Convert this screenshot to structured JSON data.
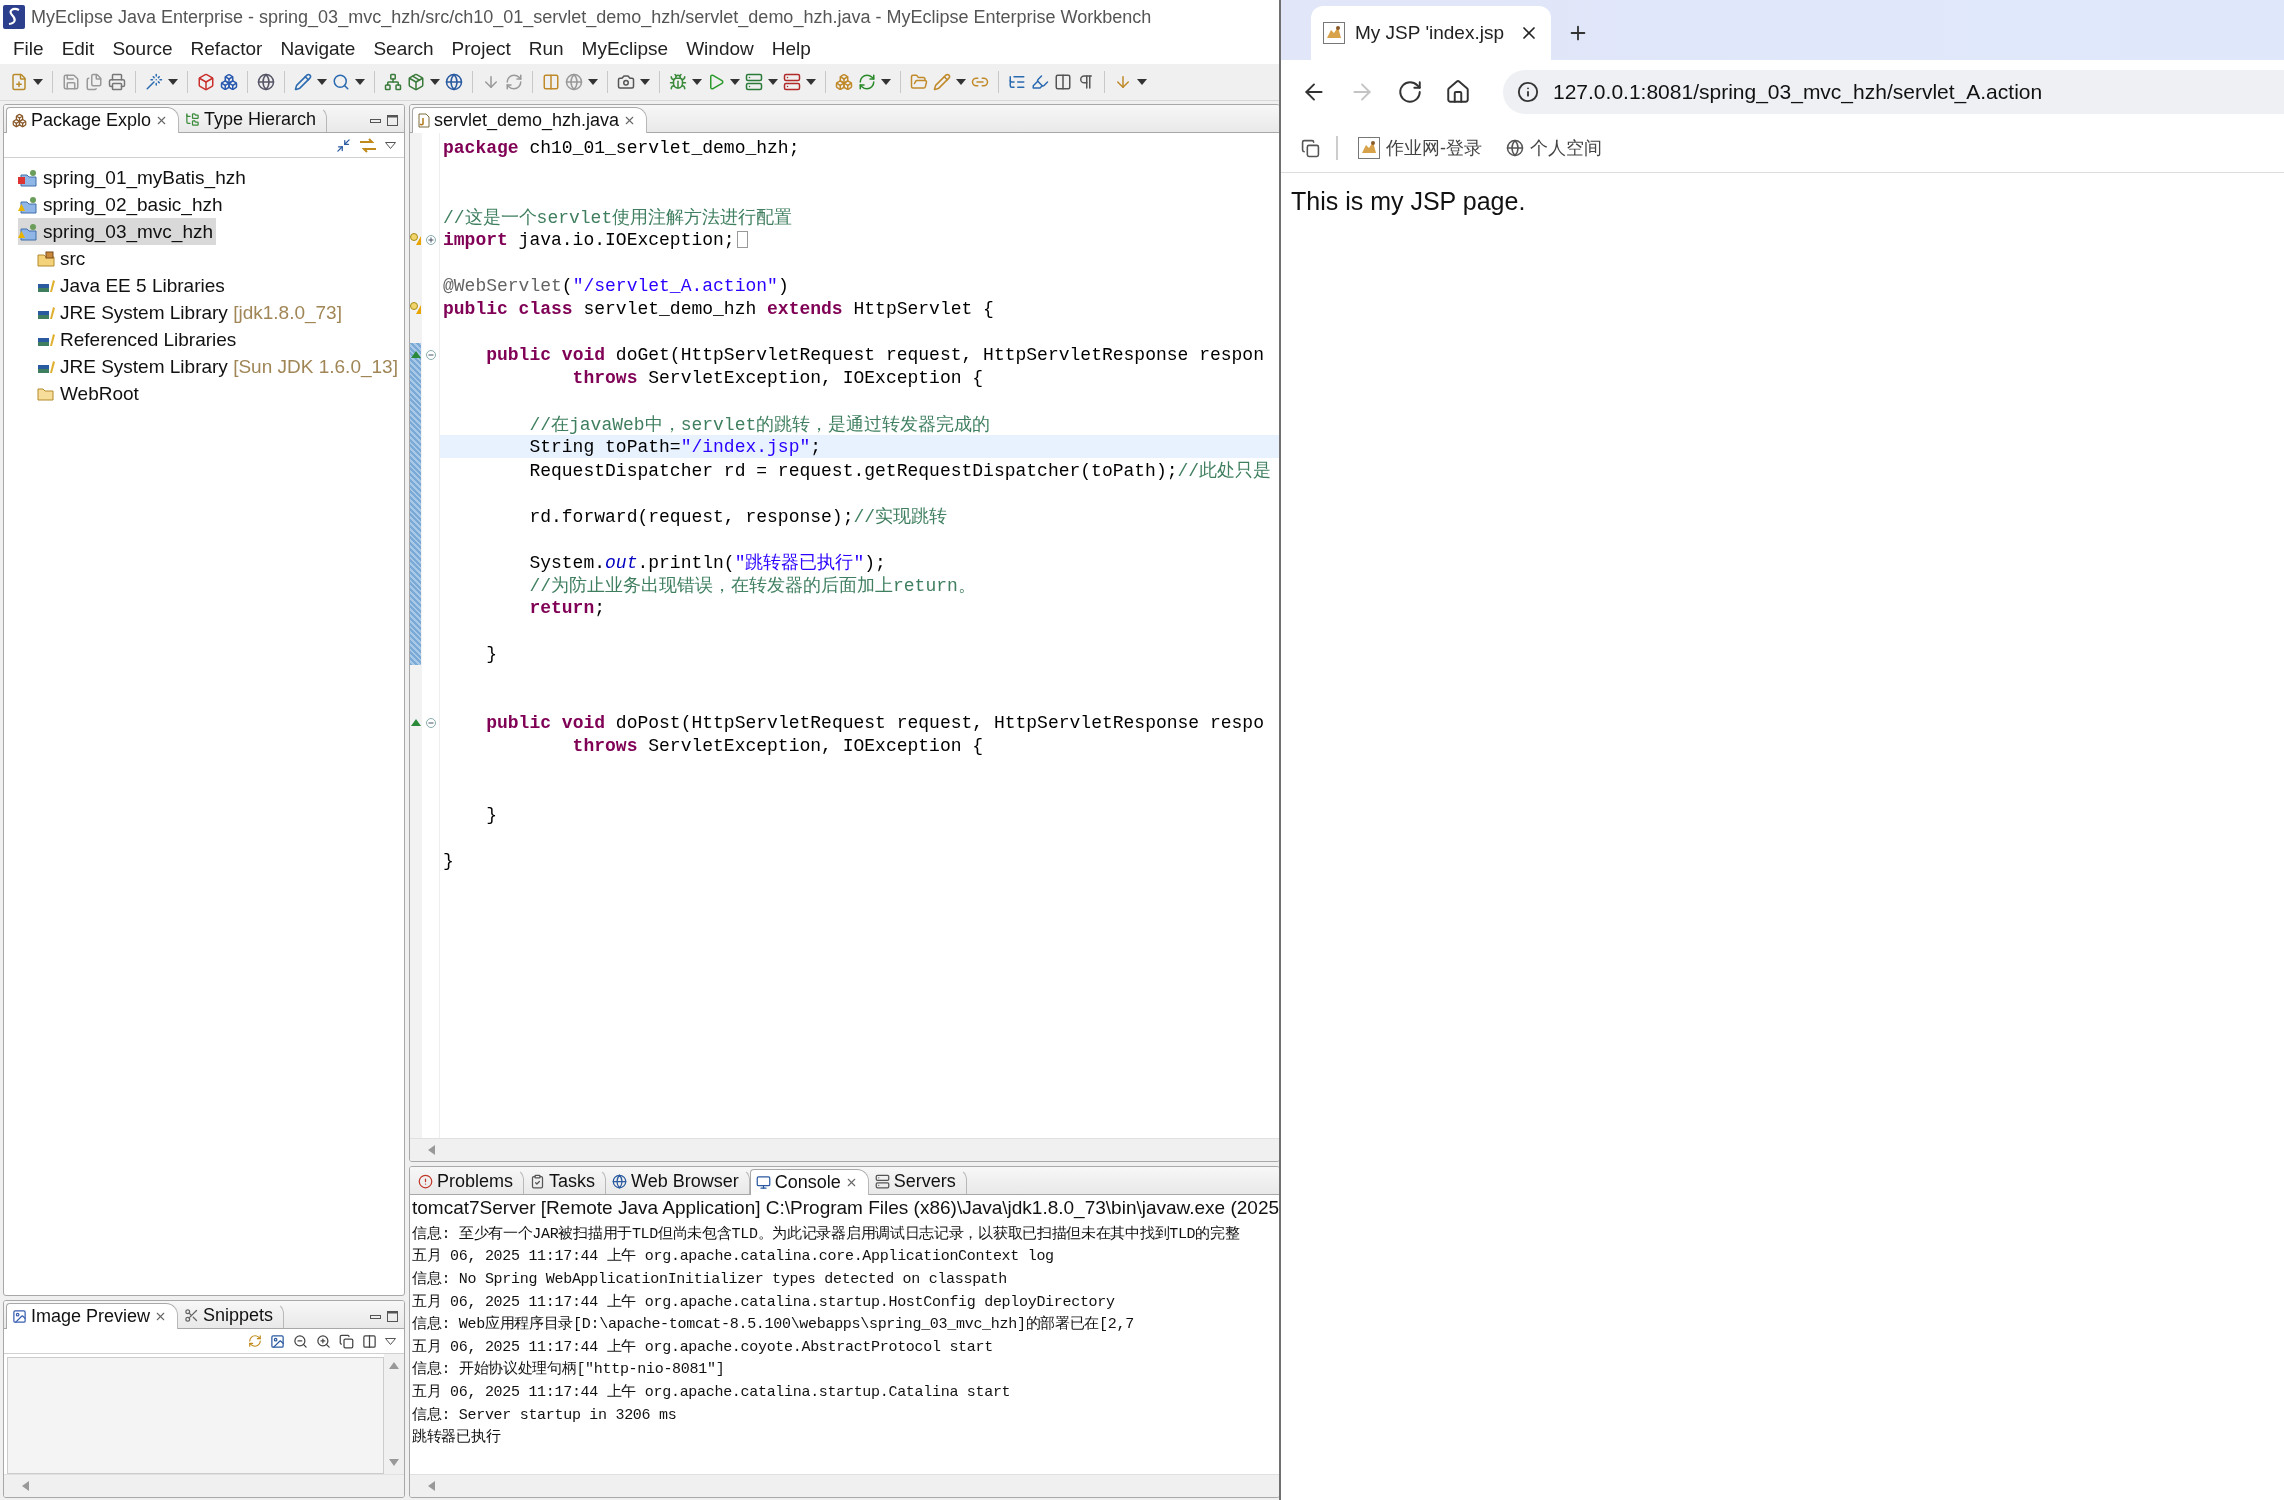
{
  "window": {
    "title": "MyEclipse Java Enterprise - spring_03_mvc_hzh/src/ch10_01_servlet_demo_hzh/servlet_demo_hzh.java - MyEclipse Enterprise Workbench"
  },
  "menu": [
    "File",
    "Edit",
    "Source",
    "Refactor",
    "Navigate",
    "Search",
    "Project",
    "Run",
    "MyEclipse",
    "Window",
    "Help"
  ],
  "explorer": {
    "tabs": [
      {
        "label": "Package Explo",
        "kind": "package",
        "selected": true
      },
      {
        "label": "Type Hierarch",
        "kind": "hierarchy",
        "selected": false
      }
    ],
    "tree": [
      {
        "label": "spring_01_myBatis_hzh",
        "kind": "project",
        "error": true,
        "warning": false,
        "selected": false
      },
      {
        "label": "spring_02_basic_hzh",
        "kind": "project",
        "error": false,
        "warning": true,
        "selected": false
      },
      {
        "label": "spring_03_mvc_hzh",
        "kind": "project",
        "error": false,
        "warning": true,
        "selected": true,
        "children": [
          {
            "label": "src",
            "kind": "source",
            "selected": false
          },
          {
            "label": "Java EE 5 Libraries",
            "kind": "library",
            "selected": false
          },
          {
            "label": "JRE System Library",
            "decoration": "[jdk1.8.0_73]",
            "kind": "library",
            "selected": false
          },
          {
            "label": "Referenced Libraries",
            "kind": "library",
            "selected": false
          },
          {
            "label": "JRE System Library",
            "decoration": "[Sun JDK 1.6.0_13]",
            "kind": "library",
            "selected": false
          },
          {
            "label": "WebRoot",
            "kind": "folder",
            "selected": false
          }
        ]
      }
    ]
  },
  "preview": {
    "tabs": [
      {
        "label": "Image Preview",
        "kind": "image",
        "selected": true
      },
      {
        "label": "Snippets",
        "kind": "snippets",
        "selected": false
      }
    ]
  },
  "editor": {
    "tabs": [
      {
        "label": "servlet_demo_hzh.java",
        "kind": "java",
        "selected": true
      }
    ],
    "lines": [
      {
        "kind": "code",
        "current": false,
        "scope": false,
        "tokens": [
          {
            "kind": "kw",
            "text": "package"
          },
          {
            "kind": "plain",
            "text": " ch10_01_servlet_demo_hzh;"
          }
        ]
      },
      {
        "kind": "blank",
        "current": false,
        "scope": false
      },
      {
        "kind": "blank",
        "current": false,
        "scope": false
      },
      {
        "kind": "code",
        "current": false,
        "scope": false,
        "tokens": [
          {
            "kind": "comment",
            "text": "//这是一个servlet使用注解方法进行配置"
          }
        ]
      },
      {
        "kind": "code",
        "current": false,
        "scope": false,
        "warning": true,
        "folded": true,
        "tokens": [
          {
            "kind": "kw",
            "text": "import"
          },
          {
            "kind": "plain",
            "text": " java.io.IOException;"
          }
        ]
      },
      {
        "kind": "blank",
        "current": false,
        "scope": false
      },
      {
        "kind": "code",
        "current": false,
        "scope": false,
        "tokens": [
          {
            "kind": "annot",
            "text": "@WebServlet"
          },
          {
            "kind": "plain",
            "text": "("
          },
          {
            "kind": "str",
            "text": "\"/servlet_A.action\""
          },
          {
            "kind": "plain",
            "text": ")"
          }
        ]
      },
      {
        "kind": "code",
        "current": false,
        "scope": false,
        "warning": true,
        "tokens": [
          {
            "kind": "kw",
            "text": "public"
          },
          {
            "kind": "kw",
            "text": " class"
          },
          {
            "kind": "plain",
            "text": " servlet_demo_hzh "
          },
          {
            "kind": "kw",
            "text": "extends"
          },
          {
            "kind": "plain",
            "text": " HttpServlet {"
          }
        ]
      },
      {
        "kind": "blank",
        "current": false,
        "scope": false
      },
      {
        "kind": "code",
        "current": false,
        "scope": true,
        "override": true,
        "folded": false,
        "tokens": [
          {
            "kind": "kw",
            "text": "    public"
          },
          {
            "kind": "kw",
            "text": " void"
          },
          {
            "kind": "plain",
            "text": " doGet(HttpServletRequest request, HttpServletResponse respon"
          }
        ]
      },
      {
        "kind": "code",
        "current": false,
        "scope": true,
        "tokens": [
          {
            "kind": "kw",
            "text": "            throws"
          },
          {
            "kind": "plain",
            "text": " ServletException, IOException {"
          }
        ]
      },
      {
        "kind": "blank",
        "current": false,
        "scope": true
      },
      {
        "kind": "code",
        "current": false,
        "scope": true,
        "tokens": [
          {
            "kind": "comment",
            "text": "        //在javaWeb中，servlet的跳转，是通过转发器完成的"
          }
        ]
      },
      {
        "kind": "code",
        "current": true,
        "scope": true,
        "tokens": [
          {
            "kind": "plain",
            "text": "        String toPath="
          },
          {
            "kind": "str",
            "text": "\"/index.jsp\""
          },
          {
            "kind": "plain",
            "text": ";"
          }
        ]
      },
      {
        "kind": "code",
        "current": false,
        "scope": true,
        "tokens": [
          {
            "kind": "plain",
            "text": "        RequestDispatcher rd = request.getRequestDispatcher(toPath);"
          },
          {
            "kind": "comment",
            "text": "//此处只是"
          }
        ]
      },
      {
        "kind": "blank",
        "current": false,
        "scope": true
      },
      {
        "kind": "code",
        "current": false,
        "scope": true,
        "tokens": [
          {
            "kind": "plain",
            "text": "        rd.forward(request, response);"
          },
          {
            "kind": "comment",
            "text": "//实现跳转"
          }
        ]
      },
      {
        "kind": "blank",
        "current": false,
        "scope": true
      },
      {
        "kind": "code",
        "current": false,
        "scope": true,
        "tokens": [
          {
            "kind": "plain",
            "text": "        System."
          },
          {
            "kind": "field",
            "text": "out"
          },
          {
            "kind": "plain",
            "text": ".println("
          },
          {
            "kind": "str",
            "text": "\"跳转器已执行\""
          },
          {
            "kind": "plain",
            "text": ");"
          }
        ]
      },
      {
        "kind": "code",
        "current": false,
        "scope": true,
        "tokens": [
          {
            "kind": "comment",
            "text": "        //为防止业务出现错误，在转发器的后面加上return。"
          }
        ]
      },
      {
        "kind": "code",
        "current": false,
        "scope": true,
        "tokens": [
          {
            "kind": "kw",
            "text": "        return"
          },
          {
            "kind": "plain",
            "text": ";"
          }
        ]
      },
      {
        "kind": "blank",
        "current": false,
        "scope": true
      },
      {
        "kind": "code",
        "current": false,
        "scope": true,
        "tokens": [
          {
            "kind": "plain",
            "text": "    }"
          }
        ]
      },
      {
        "kind": "blank",
        "current": false,
        "scope": false
      },
      {
        "kind": "blank",
        "current": false,
        "scope": false
      },
      {
        "kind": "code",
        "current": false,
        "scope": false,
        "override": true,
        "folded": false,
        "tokens": [
          {
            "kind": "kw",
            "text": "    public"
          },
          {
            "kind": "kw",
            "text": " void"
          },
          {
            "kind": "plain",
            "text": " doPost(HttpServletRequest request, HttpServletResponse respo"
          }
        ]
      },
      {
        "kind": "code",
        "current": false,
        "scope": false,
        "tokens": [
          {
            "kind": "kw",
            "text": "            throws"
          },
          {
            "kind": "plain",
            "text": " ServletException, IOException {"
          }
        ]
      },
      {
        "kind": "blank",
        "current": false,
        "scope": false
      },
      {
        "kind": "blank",
        "current": false,
        "scope": false
      },
      {
        "kind": "code",
        "current": false,
        "scope": false,
        "tokens": [
          {
            "kind": "plain",
            "text": "    }"
          }
        ]
      },
      {
        "kind": "blank",
        "current": false,
        "scope": false
      },
      {
        "kind": "code",
        "current": false,
        "scope": false,
        "tokens": [
          {
            "kind": "plain",
            "text": "}"
          }
        ]
      }
    ]
  },
  "console": {
    "tabs": [
      {
        "label": "Problems",
        "kind": "problems",
        "selected": false
      },
      {
        "label": "Tasks",
        "kind": "tasks",
        "selected": false
      },
      {
        "label": "Web Browser",
        "kind": "web",
        "selected": false
      },
      {
        "label": "Console",
        "kind": "console",
        "selected": true
      },
      {
        "label": "Servers",
        "kind": "servers",
        "selected": false
      }
    ],
    "header": "tomcat7Server [Remote Java Application] C:\\Program Files (x86)\\Java\\jdk1.8.0_73\\bin\\javaw.exe (2025",
    "lines": [
      "信息: 至少有一个JAR被扫描用于TLD但尚未包含TLD。为此记录器启用调试日志记录，以获取已扫描但未在其中找到TLD的完整",
      "五月 06, 2025 11:17:44 上午 org.apache.catalina.core.ApplicationContext log",
      "信息: No Spring WebApplicationInitializer types detected on classpath",
      "五月 06, 2025 11:17:44 上午 org.apache.catalina.startup.HostConfig deployDirectory",
      "信息: Web应用程序目录[D:\\apache-tomcat-8.5.100\\webapps\\spring_03_mvc_hzh]的部署已在[2,7",
      "五月 06, 2025 11:17:44 上午 org.apache.coyote.AbstractProtocol start",
      "信息: 开始协议处理句柄[\"http-nio-8081\"]",
      "五月 06, 2025 11:17:44 上午 org.apache.catalina.startup.Catalina start",
      "信息: Server startup in 3206 ms",
      "跳转器已执行"
    ]
  },
  "browser": {
    "tabs": [
      {
        "title": "My JSP 'index.jsp",
        "selected": true
      }
    ],
    "nav": [
      {
        "kind": "back",
        "disabled": false
      },
      {
        "kind": "forward",
        "disabled": true
      },
      {
        "kind": "reload",
        "disabled": false
      },
      {
        "kind": "home",
        "disabled": false
      }
    ],
    "url": "127.0.0.1:8081/spring_03_mvc_hzh/servlet_A.action",
    "bookmarks": [
      {
        "label": "作业网-登录",
        "kind": "site"
      },
      {
        "label": "个人空间",
        "kind": "globe"
      }
    ],
    "page_text": "This is my JSP page."
  }
}
